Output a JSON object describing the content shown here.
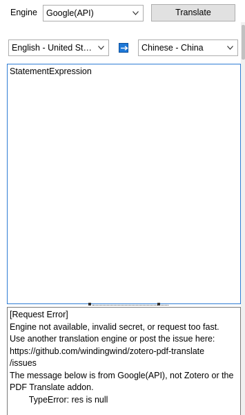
{
  "engine": {
    "label": "Engine",
    "selected": "Google(API)"
  },
  "translate_button": {
    "label": "Translate"
  },
  "languages": {
    "from": "English - United States",
    "to": "Chinese - China"
  },
  "icons": {
    "swap": "arrow-right-icon",
    "dropdown": "chevron-down-icon",
    "accent_color": "#1e78d7"
  },
  "source": {
    "text": "StatementExpression"
  },
  "result": {
    "text": "[Request Error]\nEngine not available, invalid secret, or request too fast.\nUse another translation engine or post the issue here:\nhttps://github.com/windingwind/zotero-pdf-translate\n/issues\nThe message below is from Google(API), not Zotero or the PDF Translate addon.\n\tTypeError: res is null"
  }
}
